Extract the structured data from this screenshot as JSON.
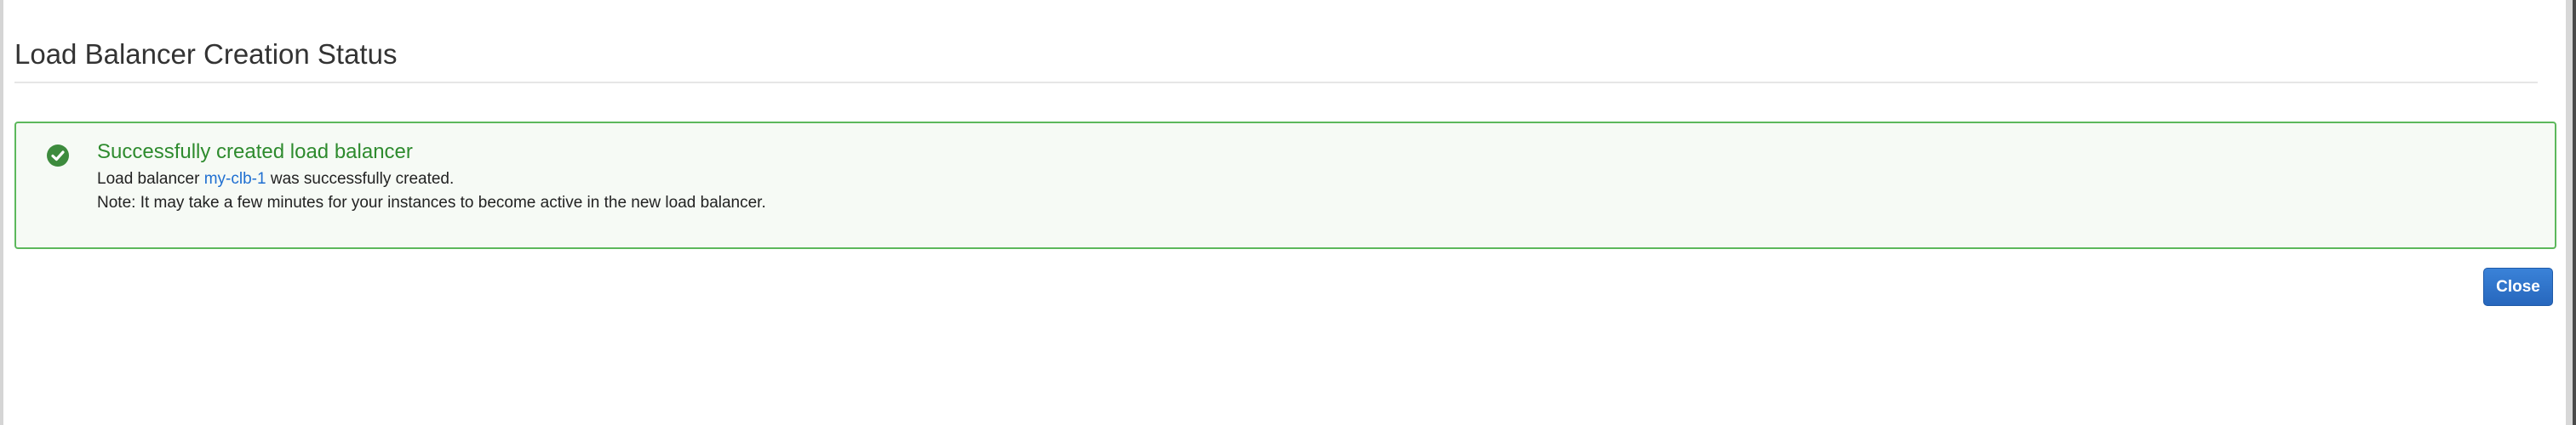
{
  "page": {
    "title": "Load Balancer Creation Status"
  },
  "alert": {
    "icon": "check-circle-icon",
    "color": "#2e8b2e",
    "title": "Successfully created load balancer",
    "line1_prefix": "Load balancer",
    "load_balancer_name": "my-clb-1",
    "line1_suffix": "was successfully created.",
    "note": "Note: It may take a few minutes for your instances to become active in the new load balancer."
  },
  "actions": {
    "close_label": "Close",
    "close_color": "#2a6ec7"
  }
}
